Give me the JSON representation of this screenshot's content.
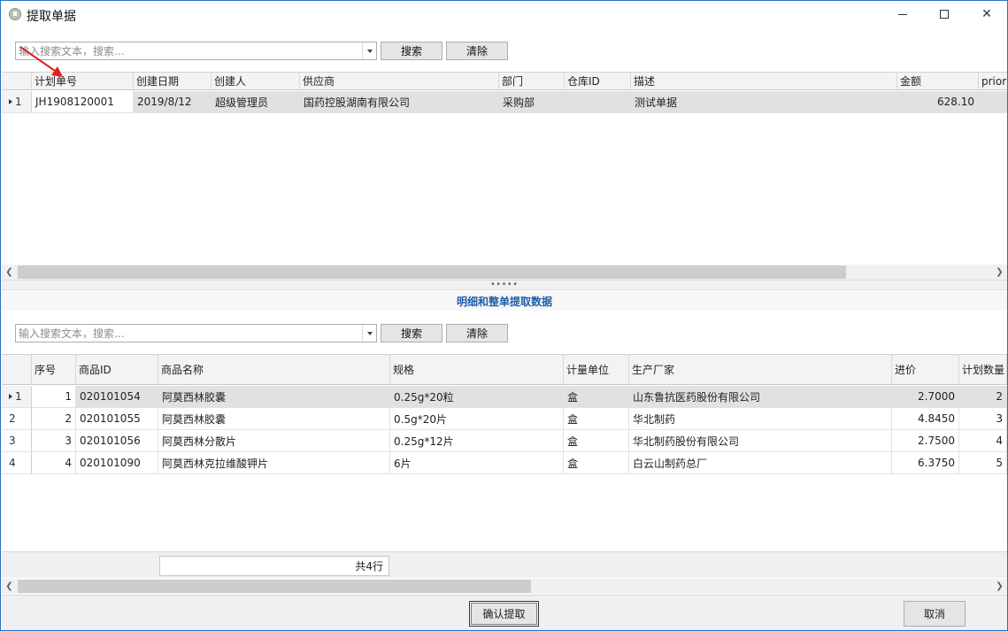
{
  "window": {
    "title": "提取单据"
  },
  "top_search": {
    "placeholder": "输入搜索文本，搜索...",
    "search_label": "搜索",
    "clear_label": "清除"
  },
  "plan_grid": {
    "columns": [
      "计划单号",
      "创建日期",
      "创建人",
      "供应商",
      "部门",
      "仓库ID",
      "描述",
      "金额",
      "priority"
    ],
    "rows": [
      {
        "index": "1",
        "plan_no": "JH1908120001",
        "created_date": "2019/8/12",
        "creator": "超级管理员",
        "supplier": "国药控股湖南有限公司",
        "department": "采购部",
        "warehouse_id": "",
        "description": "测试单据",
        "amount": "628.10",
        "priority": ""
      }
    ]
  },
  "detail_section": {
    "title": "明细和整单提取数据"
  },
  "detail_search": {
    "placeholder": "输入搜索文本，搜索...",
    "search_label": "搜索",
    "clear_label": "清除"
  },
  "detail_grid": {
    "columns": [
      "序号",
      "商品ID",
      "商品名称",
      "规格",
      "计量单位",
      "生产厂家",
      "进价",
      "计划数量"
    ],
    "rows": [
      {
        "index": "1",
        "seq": "1",
        "product_id": "020101054",
        "name": "阿莫西林胶囊",
        "spec": "0.25g*20粒",
        "unit": "盒",
        "manufacturer": "山东鲁抗医药股份有限公司",
        "price": "2.7000",
        "qty": "2"
      },
      {
        "index": "2",
        "seq": "2",
        "product_id": "020101055",
        "name": "阿莫西林胶囊",
        "spec": "0.5g*20片",
        "unit": "盒",
        "manufacturer": "华北制药",
        "price": "4.8450",
        "qty": "3"
      },
      {
        "index": "3",
        "seq": "3",
        "product_id": "020101056",
        "name": "阿莫西林分散片",
        "spec": "0.25g*12片",
        "unit": "盒",
        "manufacturer": "华北制药股份有限公司",
        "price": "2.7500",
        "qty": "4"
      },
      {
        "index": "4",
        "seq": "4",
        "product_id": "020101090",
        "name": "阿莫西林克拉维酸钾片",
        "spec": "6片",
        "unit": "盒",
        "manufacturer": "白云山制药总厂",
        "price": "6.3750",
        "qty": "5"
      }
    ],
    "total": "共4行"
  },
  "actions": {
    "confirm_label": "确认提取",
    "cancel_label": "取消"
  },
  "colors": {
    "title_accent": "#1e5fa8",
    "annotation_arrow": "#e02020",
    "window_border": "#2b6fc7"
  }
}
